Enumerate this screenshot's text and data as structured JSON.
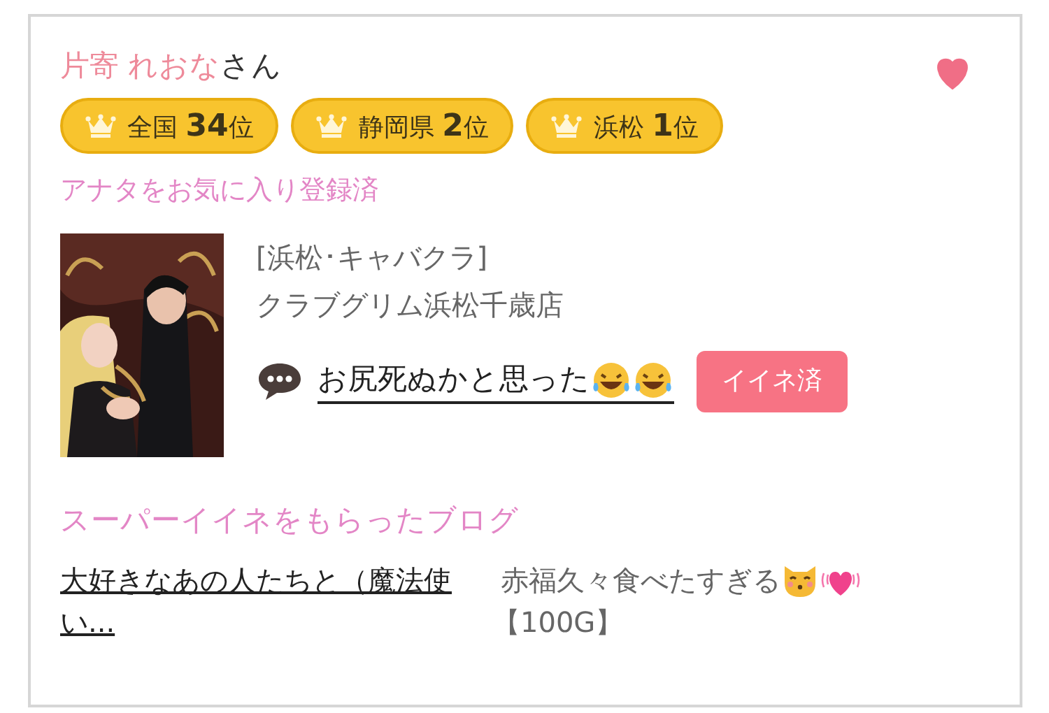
{
  "member": {
    "name": "片寄 れおな",
    "honorific": "さん",
    "favorited": true
  },
  "ranks": [
    {
      "area": "全国",
      "rank": "34",
      "suffix": "位"
    },
    {
      "area": "静岡県",
      "rank": "2",
      "suffix": "位"
    },
    {
      "area": "浜松",
      "rank": "1",
      "suffix": "位"
    }
  ],
  "favorite_status": "アナタをお気に入り登録済",
  "post": {
    "category": "[浜松･キャバクラ]",
    "shop": "クラブグリム浜松千歳店",
    "comment": "お尻死ぬかと思った",
    "like_button": {
      "label": "イイネ済",
      "liked": true
    }
  },
  "blog_section": {
    "title": "スーパーイイネをもらったブログ",
    "link": "大好きなあの人たちと（魔法使い...",
    "note": "赤福久々食べたすぎる",
    "reward": "【100G】"
  }
}
